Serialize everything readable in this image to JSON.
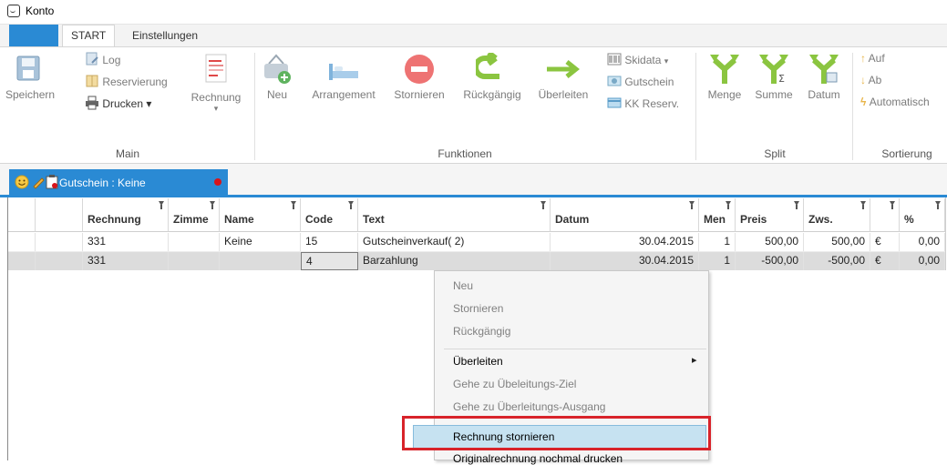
{
  "window": {
    "title": "Konto"
  },
  "tabs": {
    "start": "START",
    "settings": "Einstellungen"
  },
  "ribbon": {
    "main": {
      "save": "Speichern",
      "log": "Log",
      "reservation": "Reservierung",
      "print": "Drucken",
      "print_arrow": "▾",
      "invoice": "Rechnung",
      "group": "Main"
    },
    "functions": {
      "new": "Neu",
      "arrangement": "Arrangement",
      "cancel": "Stornieren",
      "undo": "Rückgängig",
      "transfer": "Überleiten",
      "skidata": "Skidata",
      "skidata_arrow": "▾",
      "voucher": "Gutschein",
      "kk_reserv": "KK Reserv.",
      "group": "Funktionen"
    },
    "split": {
      "quantity": "Menge",
      "sum": "Summe",
      "date": "Datum",
      "group": "Split"
    },
    "sort": {
      "up": "Auf",
      "down": "Ab",
      "auto": "Automatisch",
      "group": "Sortierung"
    }
  },
  "doctab": {
    "label": "Gutschein : Keine"
  },
  "table": {
    "columns": [
      "Rechnung",
      "Zimme",
      "Name",
      "Code",
      "Text",
      "Datum",
      "Men",
      "Preis",
      "Zws.",
      "",
      "%"
    ],
    "rows": [
      {
        "rechnung": "331",
        "zimmer": "",
        "name": "Keine",
        "code": "15",
        "text": "Gutscheinverkauf( 2)",
        "datum": "30.04.2015",
        "menge": "1",
        "preis": "500,00",
        "zws": "500,00",
        "cur": "€",
        "pct": "0,00"
      },
      {
        "rechnung": "331",
        "zimmer": "",
        "name": "",
        "code": "4",
        "text": "Barzahlung",
        "datum": "30.04.2015",
        "menge": "1",
        "preis": "-500,00",
        "zws": "-500,00",
        "cur": "€",
        "pct": "0,00"
      }
    ]
  },
  "context_menu": {
    "items": [
      "Neu",
      "Stornieren",
      "Rückgängig",
      "Überleiten",
      "Gehe zu Übeleitungs-Ziel",
      "Gehe zu Überleitungs-Ausgang",
      "Rechnung stornieren",
      "Originalrechnung nochmal drucken"
    ],
    "submenu_arrow": "▸"
  },
  "colors": {
    "accent": "#2a8ad4",
    "highlight": "#c6e2f1",
    "callout": "#d8232a"
  }
}
